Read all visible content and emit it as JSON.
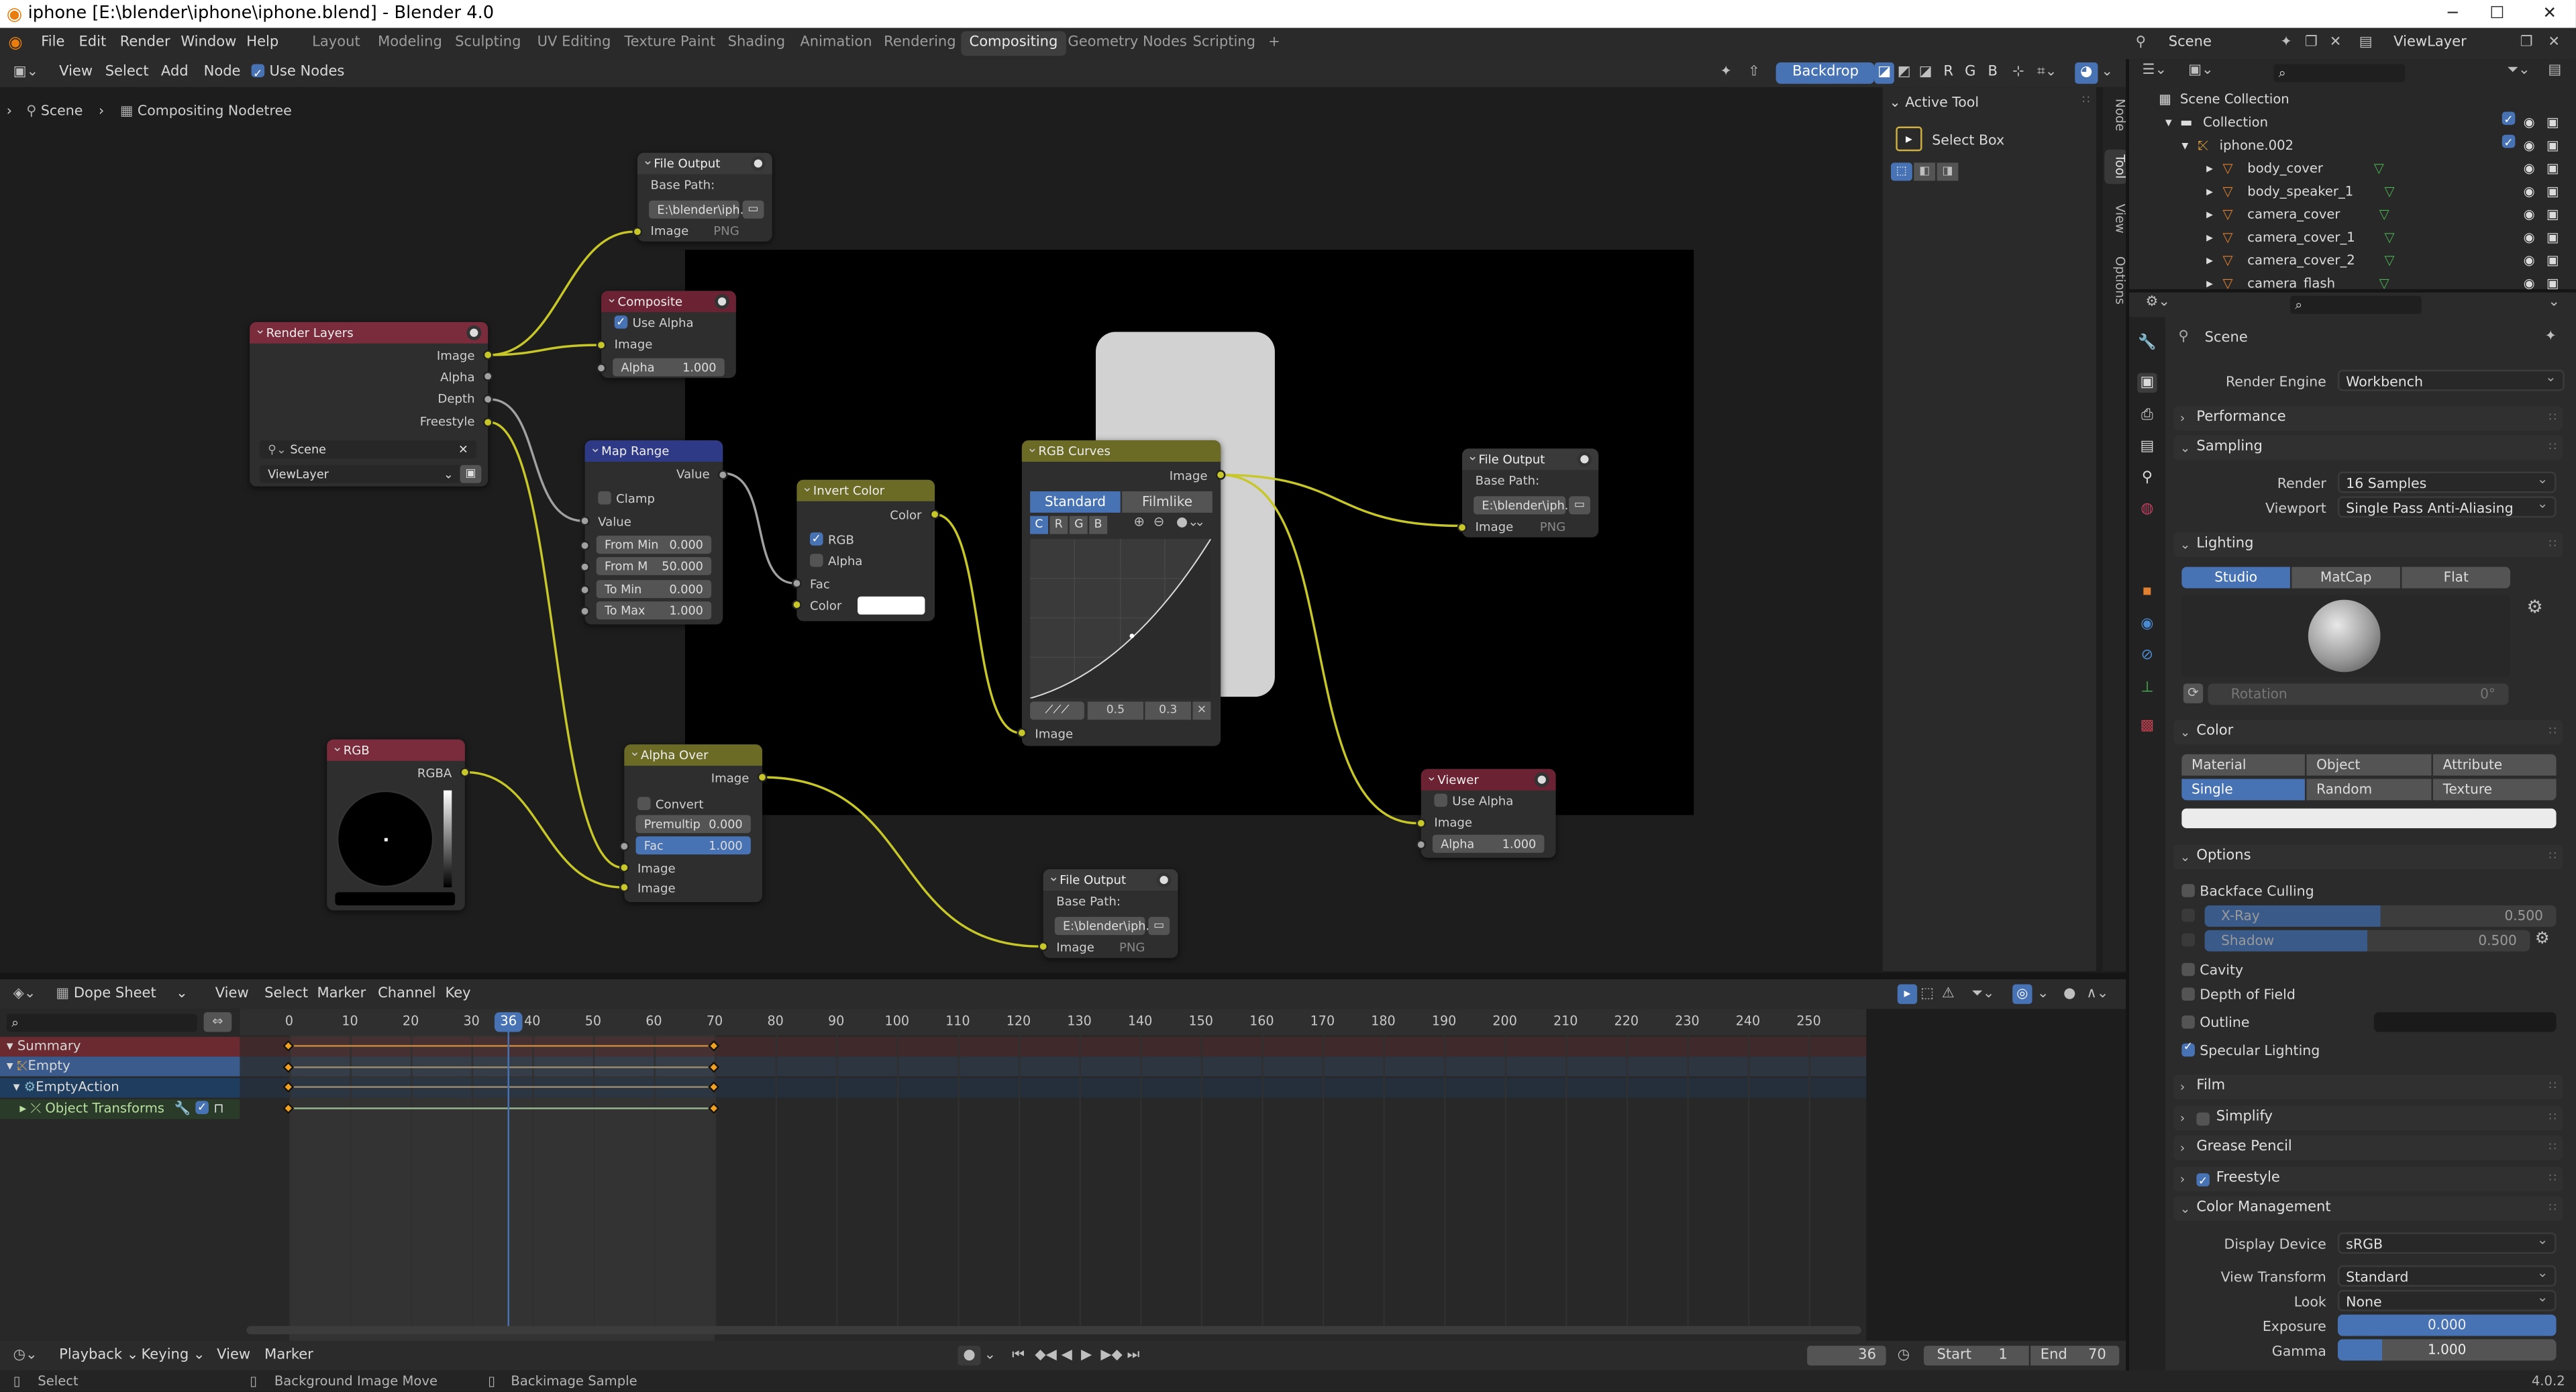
{
  "window": {
    "title": "iphone [E:\\blender\\iphone\\iphone.blend] - Blender 4.0",
    "min": "─",
    "max": "☐",
    "close": "✕"
  },
  "menubar": {
    "menus": [
      "File",
      "Edit",
      "Render",
      "Window",
      "Help"
    ],
    "workspaces": [
      "Layout",
      "Modeling",
      "Sculpting",
      "UV Editing",
      "Texture Paint",
      "Shading",
      "Animation",
      "Rendering",
      "Compositing",
      "Geometry Nodes",
      "Scripting"
    ],
    "active_workspace": "Compositing",
    "add_tab": "+",
    "scene": "Scene",
    "view_layer": "ViewLayer"
  },
  "node_editor": {
    "menus": [
      "View",
      "Select",
      "Add",
      "Node"
    ],
    "use_nodes": "Use Nodes",
    "backdrop": "Backdrop",
    "channels": [
      "R",
      "G",
      "B"
    ],
    "breadcrumb": [
      "Scene",
      "Compositing Nodetree"
    ],
    "side_tabs": [
      "Node",
      "Tool",
      "View",
      "Options"
    ],
    "active_tool_title": "Active Tool",
    "active_tool": "Select Box"
  },
  "nodes": {
    "file_output_1": {
      "title": "File Output",
      "base_path_label": "Base Path:",
      "path": "E:\\blender\\iph...",
      "input": "Image",
      "format": "PNG"
    },
    "composite": {
      "title": "Composite",
      "use_alpha": "Use Alpha",
      "input": "Image",
      "alpha_label": "Alpha",
      "alpha": "1.000"
    },
    "render_layers": {
      "title": "Render Layers",
      "outputs": [
        "Image",
        "Alpha",
        "Depth",
        "Freestyle"
      ],
      "scene": "Scene",
      "layer": "ViewLayer"
    },
    "map_range": {
      "title": "Map Range",
      "output": "Value",
      "clamp": "Clamp",
      "input": "Value",
      "fields": [
        {
          "label": "From Min",
          "value": "0.000"
        },
        {
          "label": "From M",
          "value": "50.000"
        },
        {
          "label": "To Min",
          "value": "0.000"
        },
        {
          "label": "To Max",
          "value": "1.000"
        }
      ]
    },
    "invert": {
      "title": "Invert Color",
      "output": "Color",
      "rgb": "RGB",
      "alpha": "Alpha",
      "fac": "Fac",
      "color": "Color"
    },
    "rgb_curves": {
      "title": "RGB Curves",
      "output": "Image",
      "modes": [
        "Standard",
        "Filmlike"
      ],
      "channels": [
        "C",
        "R",
        "G",
        "B"
      ],
      "x": "0.5",
      "y": "0.3",
      "input": "Image"
    },
    "file_output_2": {
      "title": "File Output",
      "base_path_label": "Base Path:",
      "path": "E:\\blender\\iph...",
      "input": "Image",
      "format": "PNG"
    },
    "rgb": {
      "title": "RGB",
      "output": "RGBA"
    },
    "alpha_over": {
      "title": "Alpha Over",
      "output": "Image",
      "convert": "Convert Premulti...",
      "premul_label": "Premultip",
      "premul": "0.000",
      "fac_label": "Fac",
      "fac": "1.000",
      "inputs": [
        "Image",
        "Image"
      ]
    },
    "file_output_3": {
      "title": "File Output",
      "base_path_label": "Base Path:",
      "path": "E:\\blender\\iph...",
      "input": "Image",
      "format": "PNG"
    },
    "viewer": {
      "title": "Viewer",
      "use_alpha": "Use Alpha",
      "input": "Image",
      "alpha_label": "Alpha",
      "alpha": "1.000"
    }
  },
  "dopesheet": {
    "mode": "Dope Sheet",
    "menus": [
      "View",
      "Select",
      "Marker",
      "Channel",
      "Key"
    ],
    "ticks": [
      "0",
      "10",
      "20",
      "30",
      "40",
      "50",
      "60",
      "70",
      "80",
      "90",
      "100",
      "110",
      "120",
      "130",
      "140",
      "150",
      "160",
      "170",
      "180",
      "190",
      "200",
      "210",
      "220",
      "230",
      "240",
      "250"
    ],
    "current_frame": "36",
    "channels": [
      "Summary",
      "Empty",
      "EmptyAction",
      "Object Transforms"
    ],
    "keyframes": [
      0,
      70
    ]
  },
  "playback": {
    "menus": [
      "Playback",
      "Keying",
      "View",
      "Marker"
    ],
    "frame": "36",
    "start_label": "Start",
    "start": "1",
    "end_label": "End",
    "end": "70"
  },
  "status": {
    "select": "Select",
    "bg_move": "Background Image Move",
    "sample": "Backimage Sample",
    "version": "4.0.2"
  },
  "outliner": {
    "root": "Scene Collection",
    "collection": "Collection",
    "object": "iphone.002",
    "children": [
      "body_cover",
      "body_speaker_1",
      "camera_cover",
      "camera_cover_1",
      "camera_cover_2",
      "camera_flash"
    ]
  },
  "properties": {
    "context": "Scene",
    "render_engine_label": "Render Engine",
    "render_engine": "Workbench",
    "sections": {
      "performance": "Performance",
      "sampling": "Sampling",
      "lighting": "Lighting",
      "color": "Color",
      "options": "Options",
      "film": "Film",
      "simplify": "Simplify",
      "grease_pencil": "Grease Pencil",
      "freestyle": "Freestyle",
      "color_management": "Color Management"
    },
    "render_label": "Render",
    "render_samples": "16 Samples",
    "viewport_label": "Viewport",
    "viewport_samples": "Single Pass Anti-Aliasing",
    "lighting_modes": [
      "Studio",
      "MatCap",
      "Flat"
    ],
    "rotation_label": "Rotation",
    "rotation": "0°",
    "color_modes": [
      "Material",
      "Object",
      "Attribute",
      "Single",
      "Random",
      "Texture"
    ],
    "backface": "Backface Culling",
    "xray_label": "X-Ray",
    "xray": "0.500",
    "shadow_label": "Shadow",
    "shadow": "0.500",
    "cavity": "Cavity",
    "dof": "Depth of Field",
    "outline": "Outline",
    "specular": "Specular Lighting",
    "display_device_label": "Display Device",
    "display_device": "sRGB",
    "view_transform_label": "View Transform",
    "view_transform": "Standard",
    "look_label": "Look",
    "look": "None",
    "exposure_label": "Exposure",
    "exposure": "0.000",
    "gamma_label": "Gamma",
    "gamma": "1.000"
  },
  "colors": {
    "accent": "#4772b3",
    "socket_yellow": "#c7c729",
    "keyframe": "#f0a020",
    "playhead": "#4772b3"
  }
}
